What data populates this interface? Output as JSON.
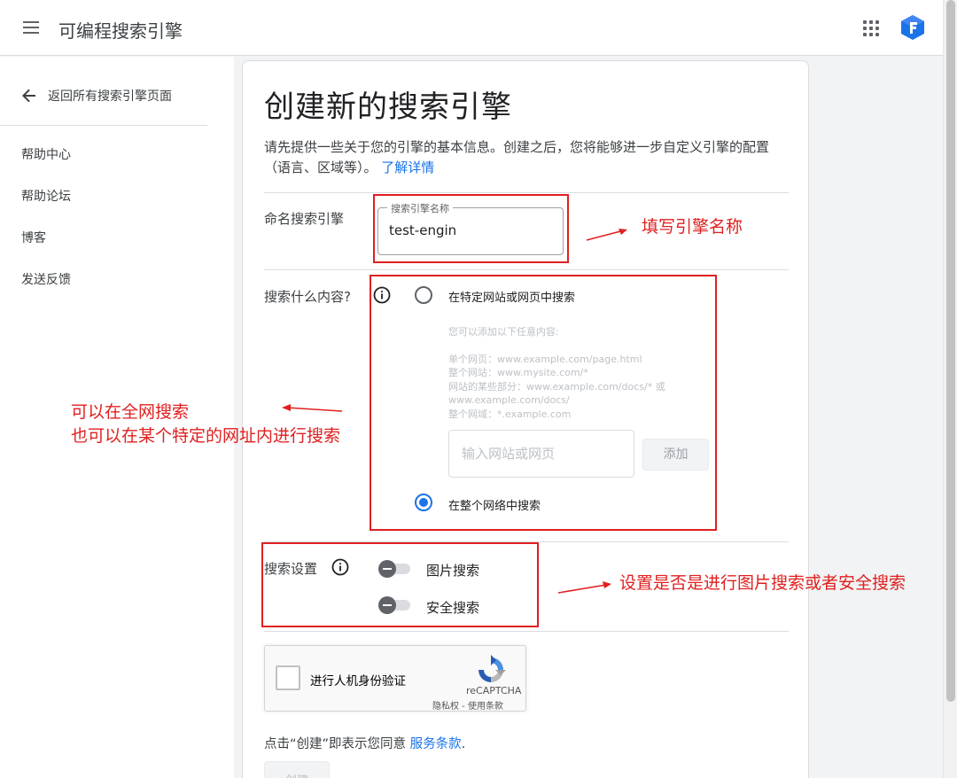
{
  "header": {
    "title": "可编程搜索引擎",
    "icons": {
      "menu": "menu-icon",
      "apps": "apps-grid-icon",
      "logo": "pse-logo-icon"
    }
  },
  "sidebar": {
    "back_label": "返回所有搜索引擎页面",
    "items": [
      {
        "label": "帮助中心"
      },
      {
        "label": "帮助论坛"
      },
      {
        "label": "博客"
      },
      {
        "label": "发送反馈"
      }
    ]
  },
  "form": {
    "title": "创建新的搜索引擎",
    "intro_text": "请先提供一些关于您的引擎的基本信息。创建之后，您将能够进一步自定义引擎的配置（语言、区域等）。",
    "intro_link": "了解详情",
    "name_section": {
      "label": "命名搜索引擎",
      "field_label": "搜索引擎名称",
      "value": "test-engin"
    },
    "content_section": {
      "label": "搜索什么内容?",
      "option_sites": "在特定网站或网页中搜索",
      "hint_title": "您可以添加以下任意内容:",
      "hint_lines": [
        "单个网页：www.example.com/page.html",
        "整个网站：www.mysite.com/*",
        "网站的某些部分：www.example.com/docs/* 或",
        "www.example.com/docs/",
        "整个网域：*.example.com"
      ],
      "site_input_placeholder": "输入网站或网页",
      "add_button": "添加",
      "option_web": "在整个网络中搜索",
      "selected": "option_web"
    },
    "settings_section": {
      "label": "搜索设置",
      "image_search": "图片搜索",
      "image_search_on": false,
      "safe_search": "安全搜索",
      "safe_search_on": false
    },
    "captcha": {
      "checkbox_label": "进行人机身份验证",
      "brand": "reCAPTCHA",
      "links": "隐私权 - 使用条款"
    },
    "terms_text": "点击“创建”即表示您同意",
    "terms_link": "服务条款",
    "terms_suffix": ".",
    "create_button": "创建"
  },
  "annotations": {
    "name_note": "填写引擎名称",
    "content_note_line1": "可以在全网搜索",
    "content_note_line2": "也可以在某个特定的网址内进行搜索",
    "settings_note": "设置是否是进行图片搜索或者安全搜索",
    "color": "#e02020"
  },
  "colors": {
    "accent": "#1a73e8",
    "annotation_red": "#e02020"
  }
}
